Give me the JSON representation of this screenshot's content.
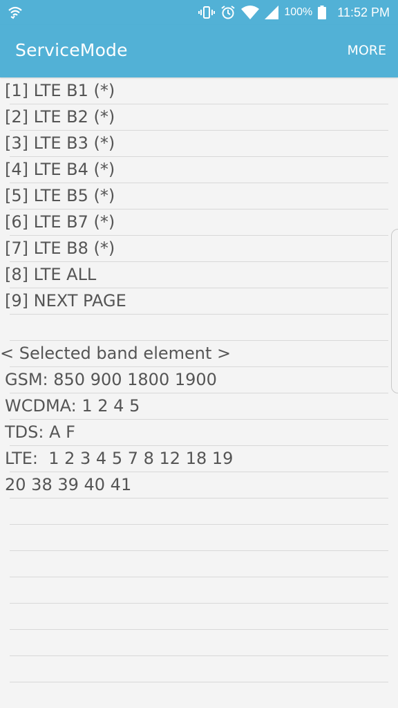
{
  "status_bar": {
    "battery_percent": "100%",
    "time": "11:52 PM"
  },
  "app_bar": {
    "title": "ServiceMode",
    "more_label": "MORE"
  },
  "menu": {
    "items": [
      "[1] LTE B1 (*)",
      "[2] LTE B2 (*)",
      "[3] LTE B3 (*)",
      "[4] LTE B4 (*)",
      "[5] LTE B5 (*)",
      "[6] LTE B7 (*)",
      "[7] LTE B8 (*)",
      "[8] LTE ALL",
      "[9] NEXT PAGE"
    ]
  },
  "info": {
    "heading": "< Selected band element >",
    "lines": [
      "GSM: 850 900 1800 1900",
      "WCDMA: 1 2 4 5",
      "TDS: A F",
      "LTE:  1 2 3 4 5 7 8 12 18 19",
      "20 38 39 40 41"
    ]
  }
}
